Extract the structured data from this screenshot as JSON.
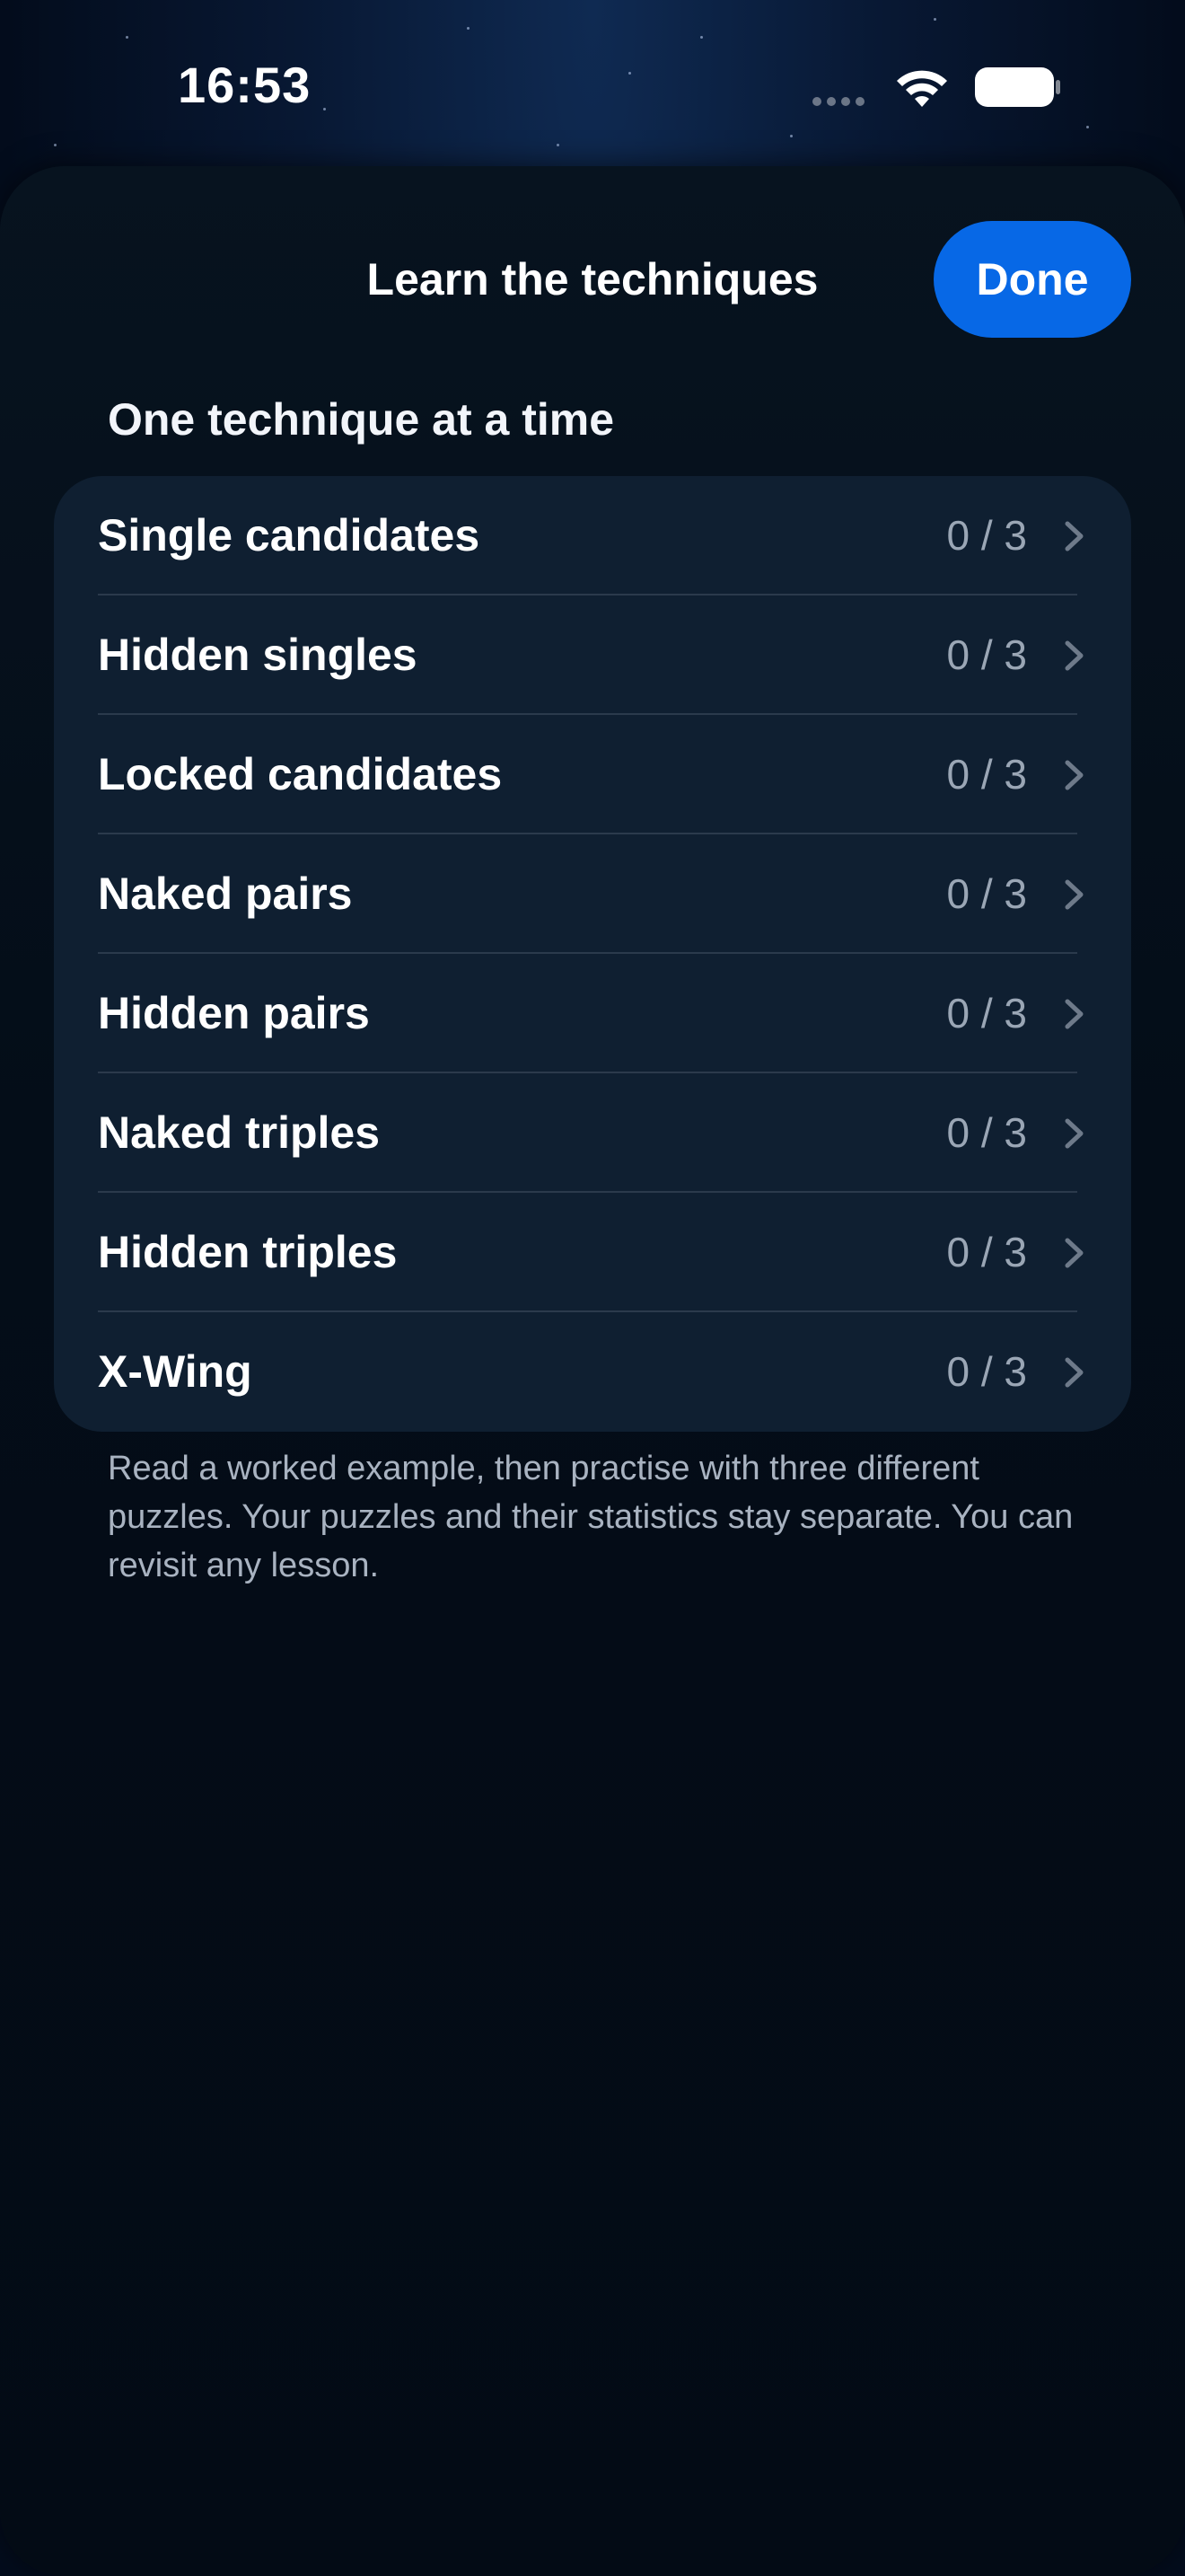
{
  "status_bar": {
    "time": "16:53"
  },
  "sheet": {
    "title": "Learn the techniques",
    "done_label": "Done"
  },
  "section": {
    "header": "One technique at a time",
    "items": [
      {
        "label": "Single candidates",
        "progress": "0 / 3"
      },
      {
        "label": "Hidden singles",
        "progress": "0 / 3"
      },
      {
        "label": "Locked candidates",
        "progress": "0 / 3"
      },
      {
        "label": "Naked pairs",
        "progress": "0 / 3"
      },
      {
        "label": "Hidden pairs",
        "progress": "0 / 3"
      },
      {
        "label": "Naked triples",
        "progress": "0 / 3"
      },
      {
        "label": "Hidden triples",
        "progress": "0 / 3"
      },
      {
        "label": "X-Wing",
        "progress": "0 / 3"
      }
    ],
    "footer": "Read a worked example, then practise with three different puzzles. Your puzzles and their statistics stay separate. You can revisit any lesson."
  },
  "colors": {
    "accent": "#0768e6",
    "background": "#020a16",
    "list_background": "#0f1f31",
    "secondary_text": "#9aa6b5"
  },
  "icons": [
    "wifi-icon",
    "battery-icon",
    "chevron-right-icon"
  ]
}
